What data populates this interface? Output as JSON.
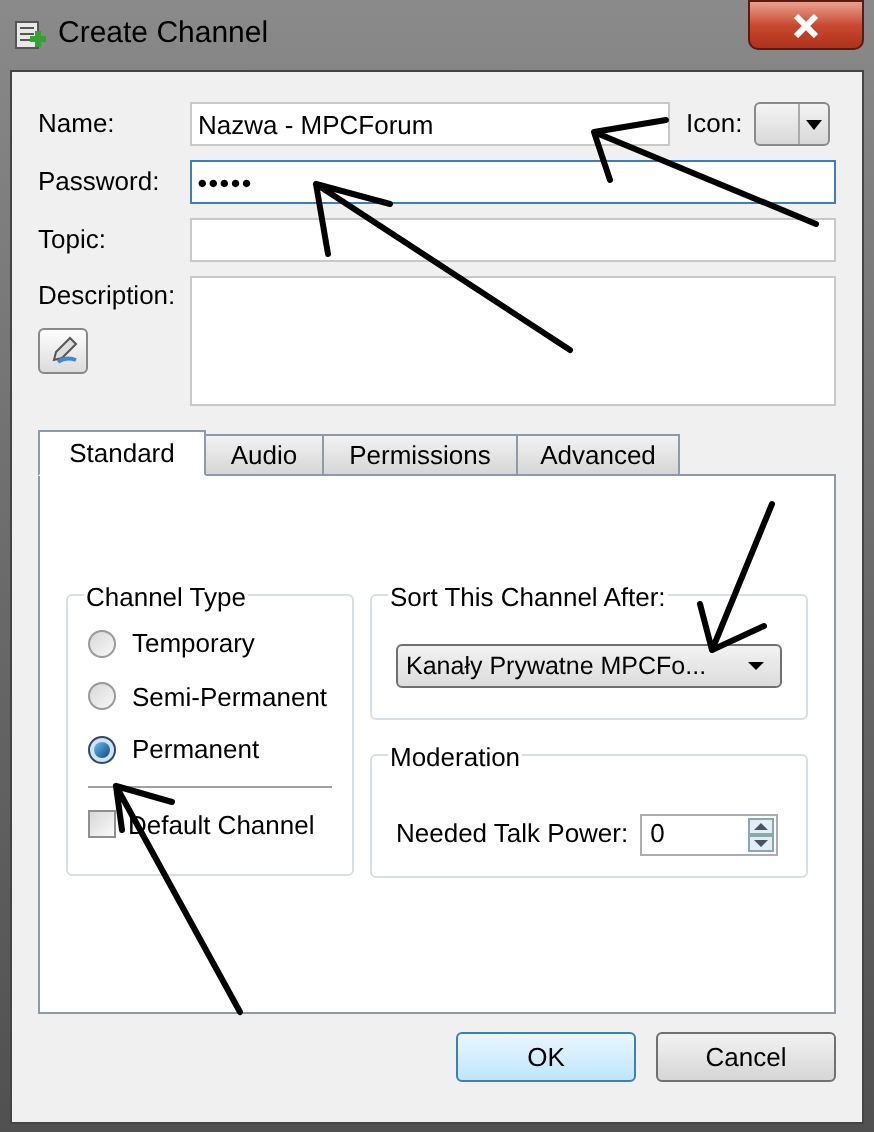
{
  "window": {
    "title": "Create Channel"
  },
  "fields": [
    {
      "label": "Name:",
      "kind": "text",
      "value": "Nazwa - MPCForum"
    },
    {
      "label": "Password:",
      "kind": "password",
      "value": "•••••",
      "focused": true
    },
    {
      "label": "Topic:",
      "kind": "text"
    }
  ],
  "icon_label": "Icon:",
  "description": {
    "label": "Description:"
  },
  "tabs": [
    {
      "label": "Standard",
      "selected": true
    },
    {
      "label": "Audio",
      "selected": false
    },
    {
      "label": "Permissions",
      "selected": false
    },
    {
      "label": "Advanced",
      "selected": false
    }
  ],
  "channel_type": {
    "title": "Channel Type",
    "options": [
      {
        "label": "Temporary",
        "selected": false
      },
      {
        "label": "Semi-Permanent",
        "selected": false
      },
      {
        "label": "Permanent",
        "selected": true
      }
    ],
    "default_channel": {
      "label": "Default Channel",
      "checked": false
    }
  },
  "sort_after": {
    "title": "Sort This Channel After:",
    "value": "Kanały Prywatne MPCFo..."
  },
  "moderation": {
    "title": "Moderation",
    "label": "Needed Talk Power:",
    "value": "0"
  },
  "buttons": [
    {
      "label": "OK",
      "default": true
    },
    {
      "label": "Cancel",
      "default": false
    }
  ]
}
